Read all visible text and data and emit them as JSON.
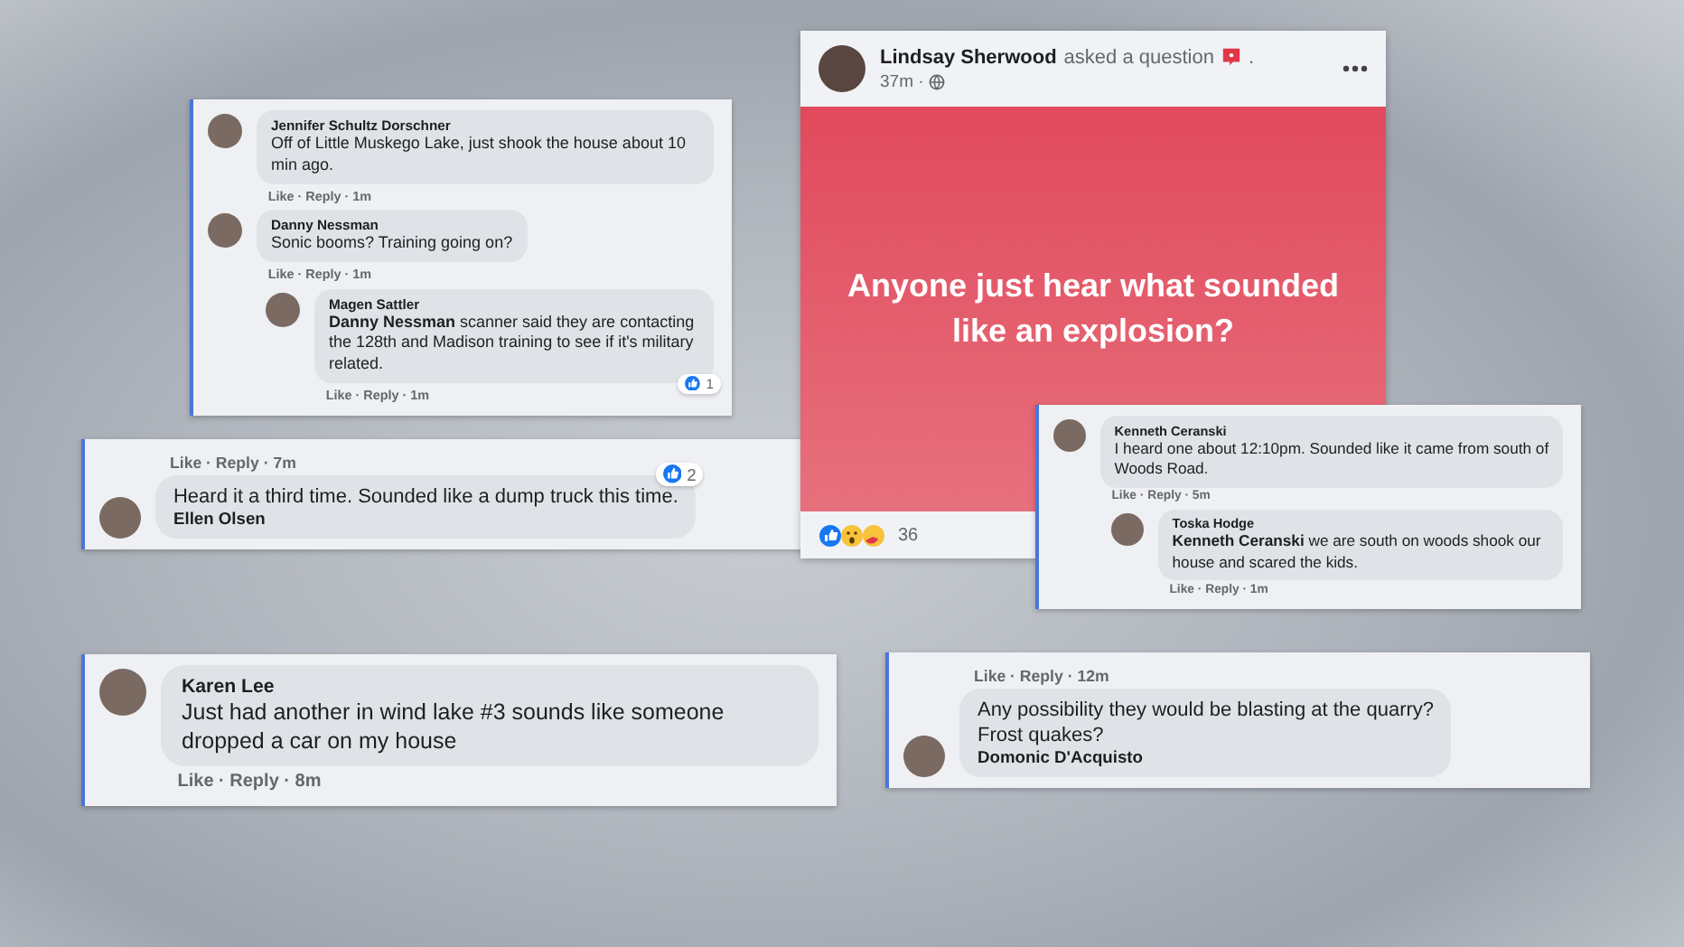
{
  "post": {
    "author": "Lindsay Sherwood",
    "action": "asked a question",
    "punctuation": ".",
    "time": "37m ·",
    "question": "Anyone just hear what sounded like an explosion?",
    "reaction_count": "36"
  },
  "cards": [
    {
      "flipped": false,
      "comments": [
        {
          "author": "Jennifer Schultz Dorschner",
          "text": "Off of Little Muskego Lake, just shook the house about 10 min ago.",
          "footer": "Like · Reply · 1m"
        },
        {
          "author": "Danny Nessman",
          "text": "Sonic booms? Training going on?",
          "footer": "Like · Reply · 1m",
          "replies": [
            {
              "author": "Magen Sattler",
              "text": "**Danny Nessman** scanner said they are contacting the 128th and Madison training to see if it's military related.",
              "footer": "Like · Reply · 1m",
              "reaction_count": "1"
            }
          ]
        }
      ]
    },
    {
      "flipped": true,
      "comments": [
        {
          "author": "Ellen Olsen",
          "text": "Heard it a third time. Sounded like a dump truck this time.",
          "footer": "Like · Reply · 7m",
          "reaction_count": "2"
        }
      ]
    },
    {
      "flipped": false,
      "comments": [
        {
          "author": "Karen Lee",
          "text": "Just had another in wind lake #3 sounds like someone dropped a car on my house",
          "footer": "Like · Reply · 8m"
        }
      ]
    },
    {
      "flipped": true,
      "comments": [
        {
          "author": "Domonic D'Acquisto",
          "text": "Any possibility they would be blasting at the quarry?\nFrost quakes?",
          "footer": "Like · Reply · 12m"
        }
      ]
    },
    {
      "flipped": false,
      "comments": [
        {
          "author": "Kenneth Ceranski",
          "text": "I heard one about 12:10pm. Sounded like it came from south of Woods Road.",
          "footer": "Like · Reply · 5m",
          "replies": [
            {
              "author": "Toska Hodge",
              "text": "**Kenneth Ceranski** we are south on woods shook our house and scared the kids.",
              "footer": "Like · Reply · 1m"
            }
          ]
        }
      ]
    }
  ]
}
